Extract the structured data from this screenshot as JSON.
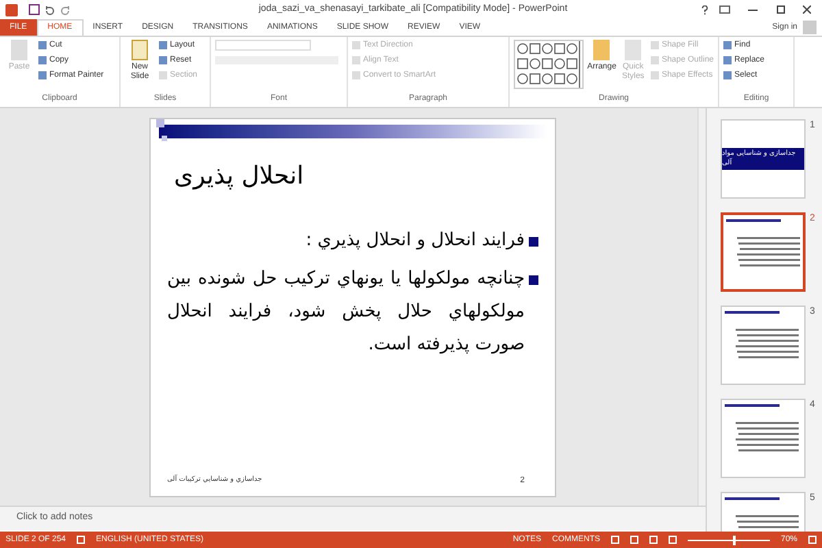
{
  "window": {
    "title": "joda_sazi_va_shenasayi_tarkibate_ali [Compatibility Mode] - PowerPoint",
    "sign_in": "Sign in"
  },
  "tabs": [
    {
      "label": "FILE",
      "kind": "file",
      "selected": false
    },
    {
      "label": "HOME",
      "kind": "tab",
      "selected": true
    },
    {
      "label": "INSERT",
      "kind": "tab",
      "selected": false
    },
    {
      "label": "DESIGN",
      "kind": "tab",
      "selected": false
    },
    {
      "label": "TRANSITIONS",
      "kind": "tab",
      "selected": false
    },
    {
      "label": "ANIMATIONS",
      "kind": "tab",
      "selected": false
    },
    {
      "label": "SLIDE SHOW",
      "kind": "tab",
      "selected": false
    },
    {
      "label": "REVIEW",
      "kind": "tab",
      "selected": false
    },
    {
      "label": "VIEW",
      "kind": "tab",
      "selected": false
    }
  ],
  "ribbon": {
    "groups": [
      {
        "label": "Clipboard",
        "kind": "buttons",
        "big": {
          "label": "Paste",
          "disabled": true
        },
        "items": [
          {
            "label": "Cut",
            "disabled": false
          },
          {
            "label": "Copy",
            "disabled": false
          },
          {
            "label": "Format Painter",
            "disabled": false
          }
        ]
      },
      {
        "label": "Slides",
        "kind": "buttons",
        "big": {
          "label": "New Slide",
          "disabled": false
        },
        "items": [
          {
            "label": "Layout",
            "disabled": false
          },
          {
            "label": "Reset",
            "disabled": false
          },
          {
            "label": "Section",
            "disabled": true
          }
        ]
      },
      {
        "label": "Font",
        "kind": "font"
      },
      {
        "label": "Paragraph",
        "kind": "buttons",
        "items": [
          {
            "label": "Text Direction",
            "disabled": true
          },
          {
            "label": "Align Text",
            "disabled": true
          },
          {
            "label": "Convert to SmartArt",
            "disabled": true
          }
        ]
      },
      {
        "label": "Drawing",
        "kind": "gallery",
        "extra": [
          {
            "label": "Arrange",
            "disabled": false
          },
          {
            "label": "Quick Styles",
            "disabled": true
          }
        ],
        "items": [
          {
            "label": "Shape Fill",
            "disabled": true
          },
          {
            "label": "Shape Outline",
            "disabled": true
          },
          {
            "label": "Shape Effects",
            "disabled": true
          }
        ]
      },
      {
        "label": "Editing",
        "kind": "buttons",
        "items": [
          {
            "label": "Find",
            "disabled": false
          },
          {
            "label": "Replace",
            "disabled": false
          },
          {
            "label": "Select",
            "disabled": false
          }
        ]
      }
    ]
  },
  "slide": {
    "title": "انحلال پذیری",
    "bullets": [
      "فرایند انحلال و انحلال پذيري :",
      "چنانچه مولکولها يا يونهاي ترکيب حل شونده بين مولکولهاي حلال پخش شود، فرايند انحلال صورت پذيرفته است."
    ],
    "footer": "جداسازي و شناسايي ترکيبات آلی",
    "page_number": "2"
  },
  "thumbnails": [
    {
      "number": "1",
      "kind": "title",
      "selected": false,
      "title": "جداسازی و شناسایی مواد آلی"
    },
    {
      "number": "2",
      "kind": "content",
      "selected": true
    },
    {
      "number": "3",
      "kind": "content",
      "selected": false
    },
    {
      "number": "4",
      "kind": "content",
      "selected": false
    },
    {
      "number": "5",
      "kind": "content",
      "selected": false
    }
  ],
  "notes": {
    "placeholder": "Click to add notes"
  },
  "status_bar": {
    "slide": "SLIDE 2 OF 254",
    "language": "ENGLISH (UNITED STATES)",
    "notes": "NOTES",
    "comments": "COMMENTS",
    "zoom": "70%",
    "level": 0.55
  }
}
